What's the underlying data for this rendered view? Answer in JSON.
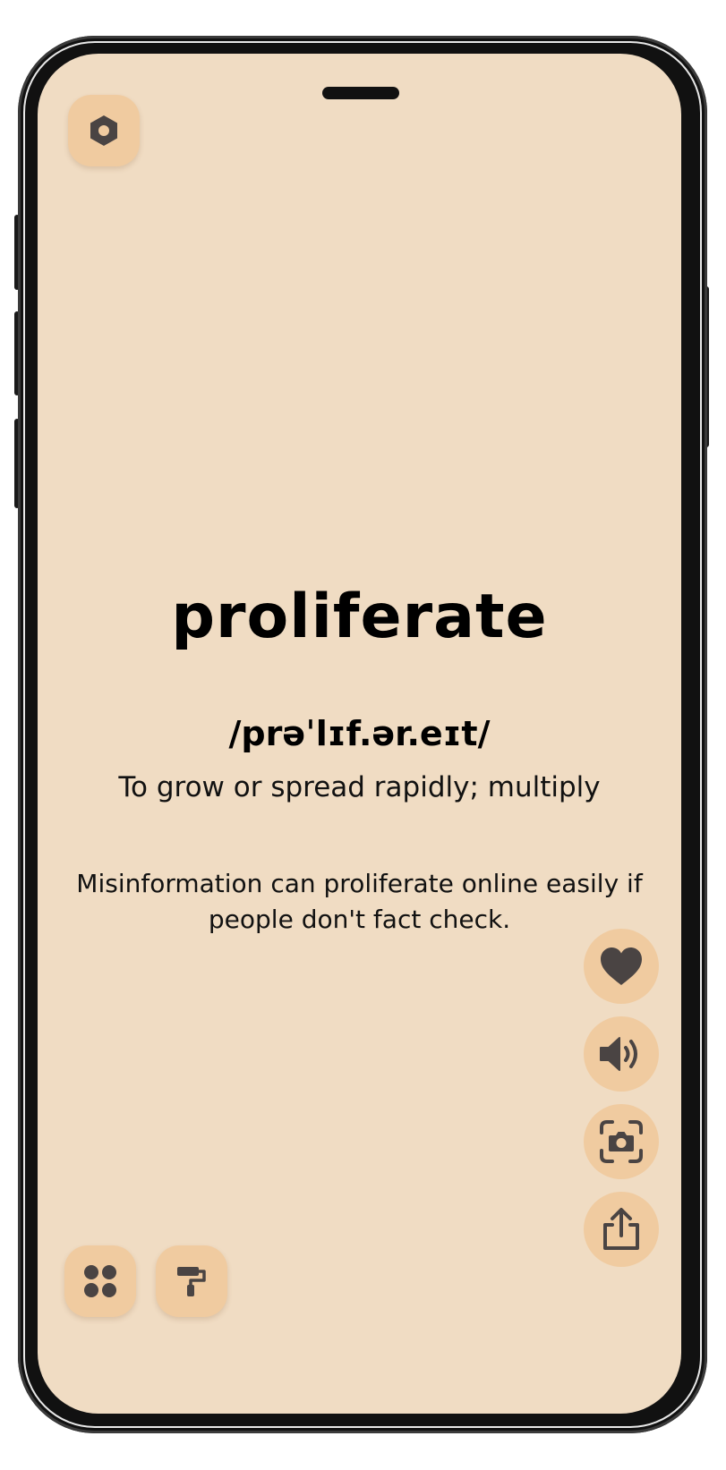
{
  "app": {
    "background_color": "#f0dcc3",
    "button_color": "#f0cba0",
    "icon_color": "#4a4443"
  },
  "top_bar": {
    "settings_icon": "hexagon-settings-icon"
  },
  "card": {
    "word": "proliferate",
    "pronunciation": "/prəˈlɪf.ər.eɪt/",
    "definition": "To grow or spread rapidly; multiply",
    "example": "Misinformation can proliferate online easily if people don't fact check."
  },
  "side_actions": [
    {
      "name": "favorite",
      "icon": "heart-icon"
    },
    {
      "name": "pronounce",
      "icon": "speaker-icon"
    },
    {
      "name": "screenshot",
      "icon": "camera-icon"
    },
    {
      "name": "share",
      "icon": "share-icon"
    }
  ],
  "bottom_bar": {
    "categories_icon": "grid-icon",
    "themes_icon": "paint-roller-icon"
  }
}
